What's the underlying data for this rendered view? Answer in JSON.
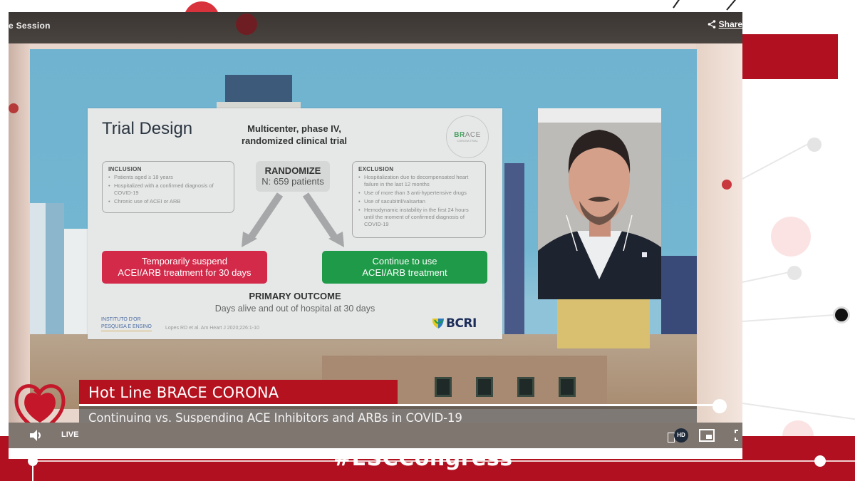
{
  "player": {
    "title": "e Session",
    "share_label": "Share",
    "live_label": "LIVE",
    "quality_badge": "HD"
  },
  "slide": {
    "title": "Trial Design",
    "subtitle_line1": "Multicenter, phase IV,",
    "subtitle_line2": "randomized clinical trial",
    "logo": {
      "brand_bold": "BR",
      "brand_rest": "ACE",
      "sub": "CORONA TRIAL"
    },
    "inclusion": {
      "heading": "INCLUSION",
      "items": [
        "Patients aged ≥ 18 years",
        "Hospitalized with a confirmed diagnosis of COVID-19",
        "Chronic use of ACEI or ARB"
      ]
    },
    "randomize": {
      "heading": "RANDOMIZE",
      "count": "N: 659 patients"
    },
    "exclusion": {
      "heading": "EXCLUSION",
      "items": [
        "Hospitalization due to decompensated heart failure in the last 12 months",
        "Use of more than 3 anti-hypertensive drugs",
        "Use of sacubitril/valsartan",
        "Hemodynamic instability in the first 24 hours until the moment of confirmed diagnosis of COVID-19"
      ]
    },
    "arms": {
      "suspend_line1": "Temporarily suspend",
      "suspend_line2": "ACEI/ARB treatment for 30 days",
      "continue_line1": "Continue to use",
      "continue_line2": "ACEI/ARB treatment"
    },
    "outcome": {
      "heading": "PRIMARY OUTCOME",
      "text": "Days alive and out of hospital at 30 days"
    },
    "institute_logo": {
      "line1": "INSTITUTO D'OR",
      "line2": "PESQUISA E ENSINO"
    },
    "citation": "Lopes RD et al. Am Heart J 2020;226:1-10",
    "sponsor_logo": "BCRI",
    "colors": {
      "suspend": "#d32a4a",
      "continue": "#1f9a48"
    }
  },
  "lower_third": {
    "title": "Hot Line BRACE CORONA",
    "subtitle": "Continuing vs. Suspending ACE Inhibitors and ARBs in COVID-19"
  },
  "branding": {
    "hashtag": "#ESCCongress",
    "accent_color": "#b01020"
  }
}
